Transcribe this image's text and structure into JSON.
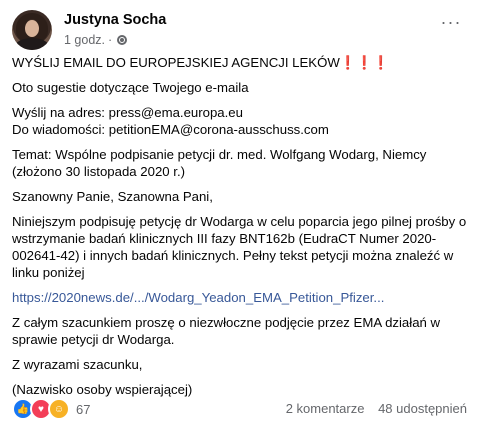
{
  "post": {
    "author": "Justyna Socha",
    "time": "1 godz.",
    "separator": "·",
    "more_label": "···",
    "icons": {
      "privacy": "globe-icon",
      "more": "more-options-icon"
    }
  },
  "content": {
    "headline": "WYŚLIJ EMAIL DO EUROPEJSKIEJ AGENCJI LEKÓW",
    "headline_marks": "❗❗❗",
    "intro": "Oto sugestie dotyczące Twojego e-maila",
    "send_to": "Wyślij na adres: press@ema.europa.eu",
    "bcc": "Do wiadomości: petitionEMA@corona-ausschuss.com",
    "subject": "Temat: Wspólne podpisanie petycji dr. med. Wolfgang Wodarg, Niemcy (złożono 30 listopada 2020 r.)",
    "greeting": "Szanowny Panie, Szanowna Pani,",
    "paragraph": "Niniejszym podpisuję petycję dr Wodarga w celu poparcia jego pilnej prośby o wstrzymanie badań klinicznych III fazy BNT162b (EudraCT Numer 2020-002641-42) i innych badań klinicznych. Pełny tekst petycji można znaleźć w linku poniżej",
    "link": "https://2020news.de/.../Wodarg_Yeadon_EMA_Petition_Pfizer...",
    "request": "Z całym szacunkiem proszę o niezwłoczne podjęcie przez EMA działań w sprawie petycji dr Wodarga.",
    "closing": "Z wyrazami szacunku,",
    "signature": "(Nazwisko osoby wspierającej)"
  },
  "footer": {
    "reaction_icons": [
      "like-icon",
      "love-icon",
      "care-icon"
    ],
    "reaction_count": "67",
    "comments": "2 komentarze",
    "shares": "48 udostępnień"
  },
  "colors": {
    "text": "#050505",
    "secondary": "#65676b",
    "link": "#385898",
    "accent_red": "#e02020",
    "like": "#1877f2",
    "love": "#f33e58",
    "care": "#f7b125"
  }
}
